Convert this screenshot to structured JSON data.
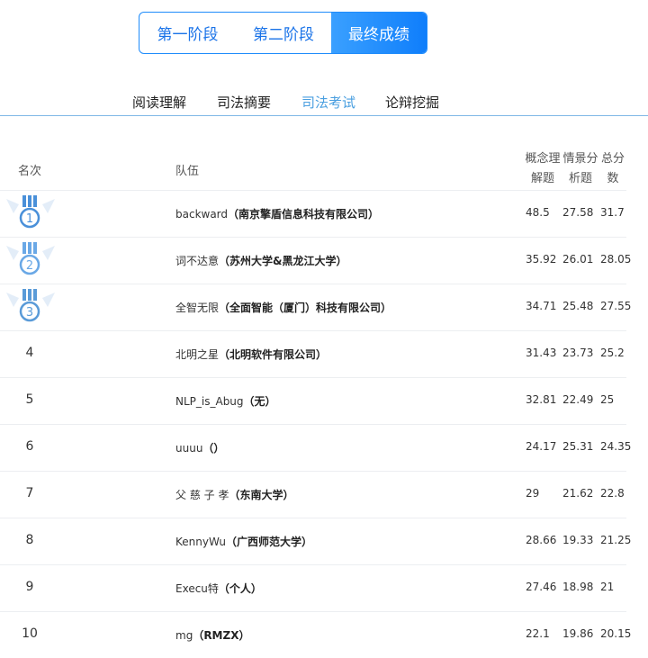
{
  "stages": [
    {
      "label": "第一阶段",
      "active": false
    },
    {
      "label": "第二阶段",
      "active": false
    },
    {
      "label": "最终成绩",
      "active": true
    }
  ],
  "tabs": [
    {
      "label": "阅读理解",
      "active": false
    },
    {
      "label": "司法摘要",
      "active": false
    },
    {
      "label": "司法考试",
      "active": true
    },
    {
      "label": "论辩挖掘",
      "active": false
    }
  ],
  "table": {
    "headers": {
      "rank": "名次",
      "team": "队伍",
      "col1_line1": "概念理",
      "col1_line2": "解题",
      "col2_line1": "情景分",
      "col2_line2": "析题",
      "col3_line1": "总分",
      "col3_line2": "数"
    },
    "rows": [
      {
        "rank": "1",
        "medal": "medal-1-icon",
        "team": "backward",
        "org": "（南京擎盾信息科技有限公司）",
        "c1": "48.5",
        "c2": "27.58",
        "total": "31.7"
      },
      {
        "rank": "2",
        "medal": "medal-2-icon",
        "team": "词不达意",
        "org": "（苏州大学&黑龙江大学）",
        "c1": "35.92",
        "c2": "26.01",
        "total": "28.05"
      },
      {
        "rank": "3",
        "medal": "medal-3-icon",
        "team": "全智无限",
        "org": "（全面智能（厦门）科技有限公司）",
        "c1": "34.71",
        "c2": "25.48",
        "total": "27.55"
      },
      {
        "rank": "4",
        "team": "北明之星",
        "org": "（北明软件有限公司）",
        "c1": "31.43",
        "c2": "23.73",
        "total": "25.2"
      },
      {
        "rank": "5",
        "team": "NLP_is_Abug",
        "org": "（无）",
        "c1": "32.81",
        "c2": "22.49",
        "total": "25"
      },
      {
        "rank": "6",
        "team": "uuuu",
        "org": "（）",
        "c1": "24.17",
        "c2": "25.31",
        "total": "24.35"
      },
      {
        "rank": "7",
        "team": "父 慈 子 孝",
        "org": "（东南大学）",
        "c1": "29",
        "c2": "21.62",
        "total": "22.8"
      },
      {
        "rank": "8",
        "team": "KennyWu",
        "org": "（广西师范大学）",
        "c1": "28.66",
        "c2": "19.33",
        "total": "21.25"
      },
      {
        "rank": "9",
        "team": "Execu特",
        "org": "（个人）",
        "c1": "27.46",
        "c2": "18.98",
        "total": "21"
      },
      {
        "rank": "10",
        "team": "mg",
        "org": "（RMZX）",
        "c1": "22.1",
        "c2": "19.86",
        "total": "20.15"
      }
    ]
  },
  "colors": {
    "accent": "#1f8cfb",
    "active_tab": "#4a9fe0",
    "medal": "#4a90d9"
  }
}
